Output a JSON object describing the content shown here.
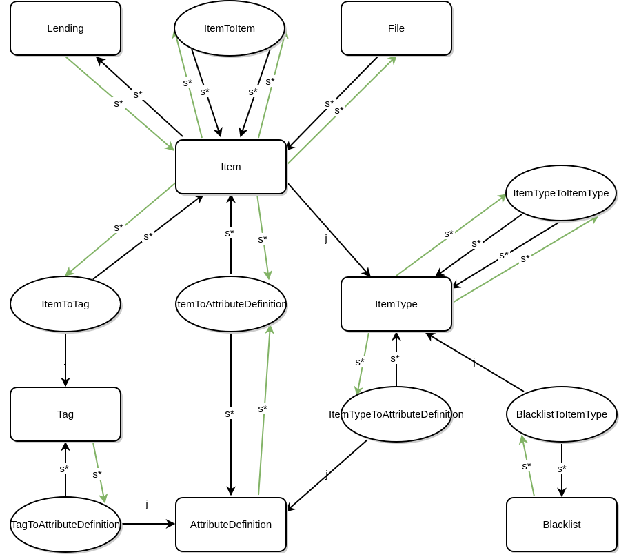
{
  "colors": {
    "black": "#000000",
    "green": "#82b366",
    "node_fill": "#ffffff",
    "shadow": "#cccccc"
  },
  "nodes": [
    {
      "id": "lending",
      "label": "Lending",
      "shape": "rounded-rect"
    },
    {
      "id": "itemtoitem",
      "label": "ItemToItem",
      "shape": "ellipse"
    },
    {
      "id": "file",
      "label": "File",
      "shape": "rounded-rect"
    },
    {
      "id": "item",
      "label": "Item",
      "shape": "rounded-rect"
    },
    {
      "id": "itemtypetoitemtype",
      "label": "ItemTypeToItemType",
      "shape": "ellipse"
    },
    {
      "id": "itemtotag",
      "label": "ItemToTag",
      "shape": "ellipse"
    },
    {
      "id": "itemtoattributedefinition",
      "label": "ItemToAttributeDefinition",
      "shape": "ellipse"
    },
    {
      "id": "itemtype",
      "label": "ItemType",
      "shape": "rounded-rect"
    },
    {
      "id": "tag",
      "label": "Tag",
      "shape": "rounded-rect"
    },
    {
      "id": "itemtypetoattributedefinition",
      "label": "ItemTypeToAttributeDefinition",
      "shape": "ellipse"
    },
    {
      "id": "blacklisttoitemtype",
      "label": "BlacklistToItemType",
      "shape": "ellipse"
    },
    {
      "id": "tagtoattributedefinition",
      "label": "TagToAttributeDefinition",
      "shape": "ellipse"
    },
    {
      "id": "attributedefinition",
      "label": "AttributeDefinition",
      "shape": "rounded-rect"
    },
    {
      "id": "blacklist",
      "label": "Blacklist",
      "shape": "rounded-rect"
    }
  ],
  "edges": [
    {
      "from": "item",
      "to": "lending",
      "label": "s*",
      "color": "black"
    },
    {
      "from": "lending",
      "to": "item",
      "label": "s*",
      "color": "green"
    },
    {
      "from": "item",
      "to": "itemtoitem",
      "label": "s*",
      "color": "green"
    },
    {
      "from": "itemtoitem",
      "to": "item",
      "label": "s*",
      "color": "black"
    },
    {
      "from": "itemtoitem",
      "to": "item",
      "label": "s*",
      "color": "black"
    },
    {
      "from": "item",
      "to": "itemtoitem",
      "label": "s*",
      "color": "green"
    },
    {
      "from": "file",
      "to": "item",
      "label": "s*",
      "color": "black"
    },
    {
      "from": "item",
      "to": "file",
      "label": "s*",
      "color": "green"
    },
    {
      "from": "item",
      "to": "itemtotag",
      "label": "s*",
      "color": "green"
    },
    {
      "from": "itemtotag",
      "to": "item",
      "label": "s*",
      "color": "black"
    },
    {
      "from": "itemtoattributedefinition",
      "to": "item",
      "label": "s*",
      "color": "black"
    },
    {
      "from": "item",
      "to": "itemtoattributedefinition",
      "label": "s*",
      "color": "green"
    },
    {
      "from": "item",
      "to": "itemtype",
      "label": "j",
      "color": "black"
    },
    {
      "from": "itemtype",
      "to": "itemtypetoitemtype",
      "label": "s*",
      "color": "green"
    },
    {
      "from": "itemtypetoitemtype",
      "to": "itemtype",
      "label": "s*",
      "color": "black"
    },
    {
      "from": "itemtypetoitemtype",
      "to": "itemtype",
      "label": "s*",
      "color": "black"
    },
    {
      "from": "itemtype",
      "to": "itemtypetoitemtype",
      "label": "s*",
      "color": "green"
    },
    {
      "from": "itemtotag",
      "to": "tag",
      "label": "j",
      "color": "black"
    },
    {
      "from": "itemtoattributedefinition",
      "to": "attributedefinition",
      "label": "s*",
      "color": "black"
    },
    {
      "from": "attributedefinition",
      "to": "itemtoattributedefinition",
      "label": "s*",
      "color": "green"
    },
    {
      "from": "itemtype",
      "to": "itemtypetoattributedefinition",
      "label": "s*",
      "color": "green"
    },
    {
      "from": "itemtypetoattributedefinition",
      "to": "itemtype",
      "label": "s*",
      "color": "black"
    },
    {
      "from": "blacklisttoitemtype",
      "to": "itemtype",
      "label": "j",
      "color": "black"
    },
    {
      "from": "itemtypetoattributedefinition",
      "to": "attributedefinition",
      "label": "j",
      "color": "black"
    },
    {
      "from": "blacklist",
      "to": "blacklisttoitemtype",
      "label": "s*",
      "color": "green"
    },
    {
      "from": "blacklisttoitemtype",
      "to": "blacklist",
      "label": "s*",
      "color": "black"
    },
    {
      "from": "tagtoattributedefinition",
      "to": "tag",
      "label": "s*",
      "color": "black"
    },
    {
      "from": "tag",
      "to": "tagtoattributedefinition",
      "label": "s*",
      "color": "green"
    },
    {
      "from": "tagtoattributedefinition",
      "to": "attributedefinition",
      "label": "j",
      "color": "black"
    }
  ]
}
